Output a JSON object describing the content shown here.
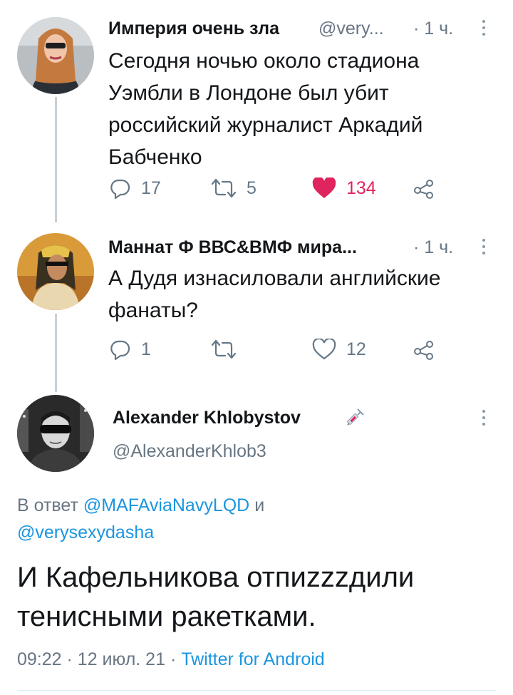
{
  "tweet1": {
    "name": "Империя очень зла",
    "handle": "@very...",
    "time": "· 1 ч.",
    "text": "Сегодня ночью около стадиона Уэмбли в Лондоне был убит российский журналист Аркадий Бабченко",
    "replies": "17",
    "retweets": "5",
    "likes": "134",
    "liked": true
  },
  "tweet2": {
    "name": "Маннат Ф ВВС&ВМФ мира...",
    "time": "· 1 ч.",
    "text": "А Дудя изнасиловали английские фанаты?",
    "replies": "1",
    "retweets": "",
    "likes": "12"
  },
  "main": {
    "name": "Alexander Khlobystov",
    "handle": "@AlexanderKhlob3",
    "reply_prefix": "В ответ",
    "reply_to_1": "@MAFAviaNavyLQD",
    "reply_and": "и",
    "reply_to_2": "@verysexydasha",
    "text": "И Кафельникова отпиzzzдили тенисными ракетками.",
    "time": "09:22",
    "date": "· 12 июл. 21 ·",
    "source": "Twitter for Android"
  },
  "colors": {
    "like_red": "#e0245e",
    "link_blue": "#1b95e0",
    "muted": "#687684"
  },
  "icons": [
    "reply-icon",
    "retweet-icon",
    "like-icon",
    "share-icon",
    "more-icon",
    "syringe-icon"
  ]
}
